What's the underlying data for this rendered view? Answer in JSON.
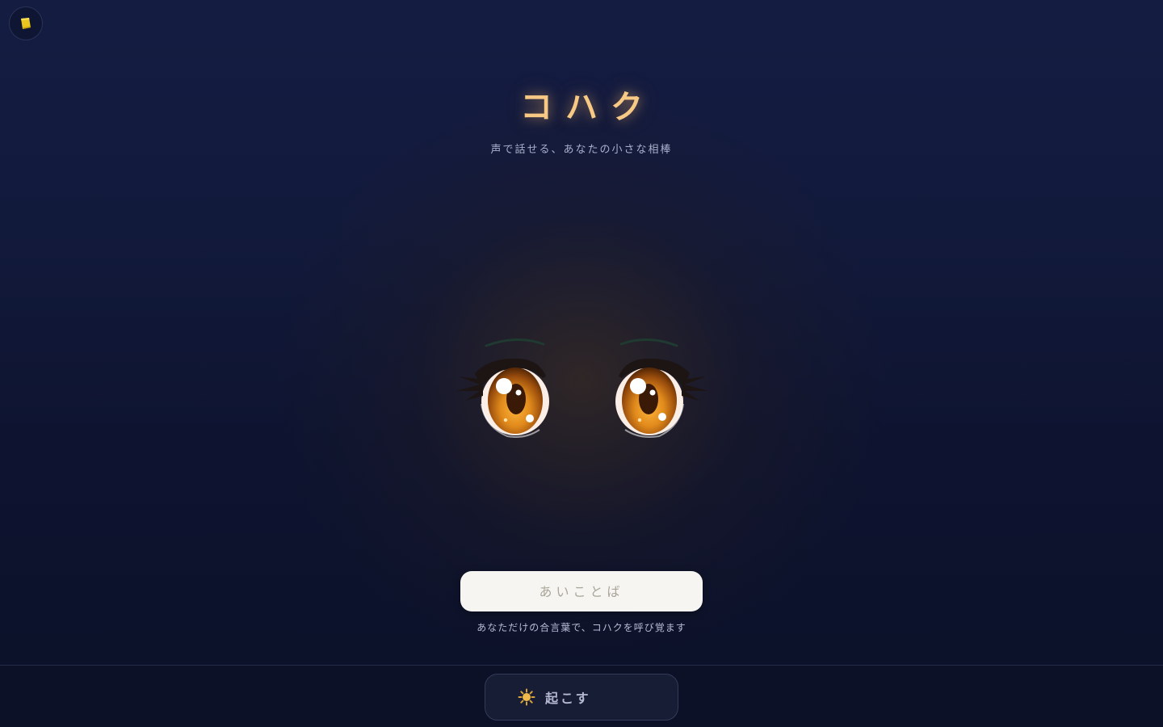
{
  "app": {
    "title": "コハク",
    "subtitle": "声で話せる、あなたの小さな相棒"
  },
  "corner_button": {
    "icon": "note-icon"
  },
  "passphrase": {
    "placeholder": "あいことば",
    "value": "",
    "hint": "あなただけの合言葉で、コハクを呼び覚ます"
  },
  "wake_button": {
    "icon": "sun-icon",
    "label": "起こす"
  },
  "colors": {
    "title": "#f7c984",
    "background_top": "#141c42",
    "background_bottom": "#0b1128",
    "iris": "#c2741a",
    "input_background": "#f6f5f2"
  }
}
